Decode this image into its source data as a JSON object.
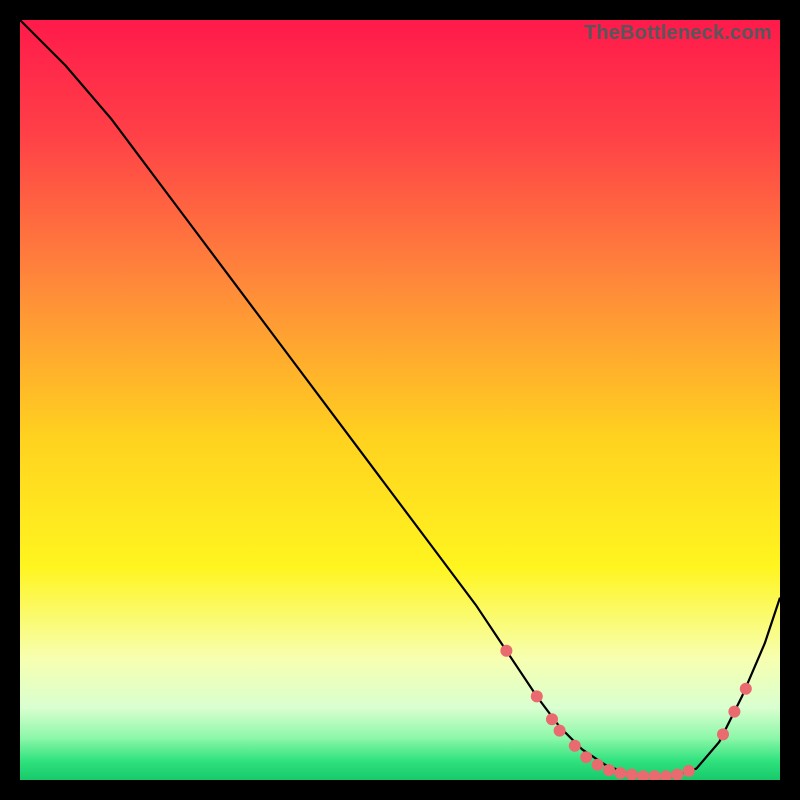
{
  "watermark": "TheBottleneck.com",
  "chart_data": {
    "type": "line",
    "title": "",
    "xlabel": "",
    "ylabel": "",
    "xlim": [
      0,
      100
    ],
    "ylim": [
      0,
      100
    ],
    "grid": false,
    "legend": false,
    "background_gradient": {
      "stops": [
        {
          "offset": 0.0,
          "color": "#ff1a4b"
        },
        {
          "offset": 0.15,
          "color": "#ff4047"
        },
        {
          "offset": 0.35,
          "color": "#ff8a3a"
        },
        {
          "offset": 0.55,
          "color": "#ffd21f"
        },
        {
          "offset": 0.72,
          "color": "#fff51f"
        },
        {
          "offset": 0.84,
          "color": "#f7ffb0"
        },
        {
          "offset": 0.905,
          "color": "#d9ffd0"
        },
        {
          "offset": 0.945,
          "color": "#8cf7a8"
        },
        {
          "offset": 0.975,
          "color": "#2fe27e"
        },
        {
          "offset": 1.0,
          "color": "#17c96a"
        }
      ]
    },
    "series": [
      {
        "name": "bottleneck-curve",
        "color": "#000000",
        "x": [
          0,
          6,
          12,
          18,
          24,
          30,
          36,
          42,
          48,
          54,
          60,
          64,
          68,
          71,
          74,
          77,
          80,
          83,
          86,
          89,
          92,
          95,
          98,
          100
        ],
        "y": [
          100,
          94,
          87,
          79,
          71,
          63,
          55,
          47,
          39,
          31,
          23,
          17,
          11,
          7,
          4,
          2,
          0.8,
          0.5,
          0.5,
          1.5,
          5,
          11,
          18,
          24
        ]
      }
    ],
    "markers": {
      "name": "highlight-dots",
      "color": "#e96a6f",
      "radius": 6,
      "points": [
        {
          "x": 64,
          "y": 17
        },
        {
          "x": 68,
          "y": 11
        },
        {
          "x": 70,
          "y": 8
        },
        {
          "x": 71,
          "y": 6.5
        },
        {
          "x": 73,
          "y": 4.5
        },
        {
          "x": 74.5,
          "y": 3
        },
        {
          "x": 76,
          "y": 2
        },
        {
          "x": 77.5,
          "y": 1.3
        },
        {
          "x": 79,
          "y": 0.9
        },
        {
          "x": 80.5,
          "y": 0.7
        },
        {
          "x": 82,
          "y": 0.5
        },
        {
          "x": 83.5,
          "y": 0.5
        },
        {
          "x": 85,
          "y": 0.5
        },
        {
          "x": 86.5,
          "y": 0.7
        },
        {
          "x": 88,
          "y": 1.2
        },
        {
          "x": 92.5,
          "y": 6
        },
        {
          "x": 94,
          "y": 9
        },
        {
          "x": 95.5,
          "y": 12
        }
      ]
    }
  }
}
